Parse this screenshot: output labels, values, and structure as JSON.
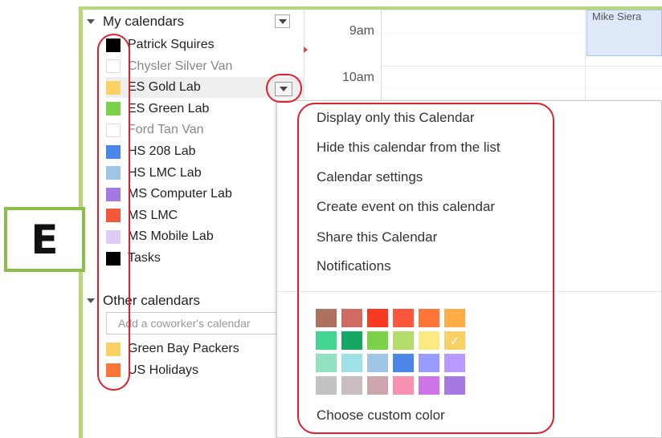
{
  "sidebar": {
    "my_calendars_label": "My calendars",
    "other_calendars_label": "Other calendars",
    "my_calendars": [
      {
        "label": "Patrick Squires",
        "color": "#000000"
      },
      {
        "label": "Chysler Silver Van",
        "color": ""
      },
      {
        "label": "ES Gold Lab",
        "color": "#fad165"
      },
      {
        "label": "ES Green Lab",
        "color": "#7bd148"
      },
      {
        "label": "Ford Tan Van",
        "color": ""
      },
      {
        "label": "HS 208 Lab",
        "color": "#4986e7"
      },
      {
        "label": "HS LMC Lab",
        "color": "#9fc6e7"
      },
      {
        "label": "MS Computer Lab",
        "color": "#a47ae2"
      },
      {
        "label": "MS LMC",
        "color": "#f4583a"
      },
      {
        "label": "MS Mobile Lab",
        "color": "#dccbf5"
      },
      {
        "label": "Tasks",
        "color": "#000000"
      }
    ],
    "coworker_placeholder": "Add a coworker's calendar",
    "other_calendars": [
      {
        "label": "Green Bay Packers",
        "color": "#fad165"
      },
      {
        "label": "US Holidays",
        "color": "#ff7537"
      }
    ]
  },
  "grid": {
    "times": [
      "9am",
      "10am"
    ],
    "event_title": "Mike Siera"
  },
  "menu": {
    "items": [
      "Display only this Calendar",
      "Hide this calendar from the list",
      "Calendar settings",
      "Create event on this calendar",
      "Share this Calendar",
      "Notifications"
    ],
    "palette": [
      "#ac725e",
      "#d06b64",
      "#f83a22",
      "#fa573c",
      "#ff7537",
      "#ffad46",
      "#42d692",
      "#16a765",
      "#7bd148",
      "#b3dc6c",
      "#fbe983",
      "#fad165",
      "#92e1c0",
      "#9fe1e7",
      "#9fc6e7",
      "#4986e7",
      "#9a9cff",
      "#b99aff",
      "#c2c2c2",
      "#cabdbf",
      "#cca6ac",
      "#f691b2",
      "#cd74e6",
      "#a47ae2"
    ],
    "selected_color": "#fad165",
    "check_glyph": "✓",
    "custom_color_label": "Choose custom color"
  },
  "annotation": {
    "label": "E"
  }
}
